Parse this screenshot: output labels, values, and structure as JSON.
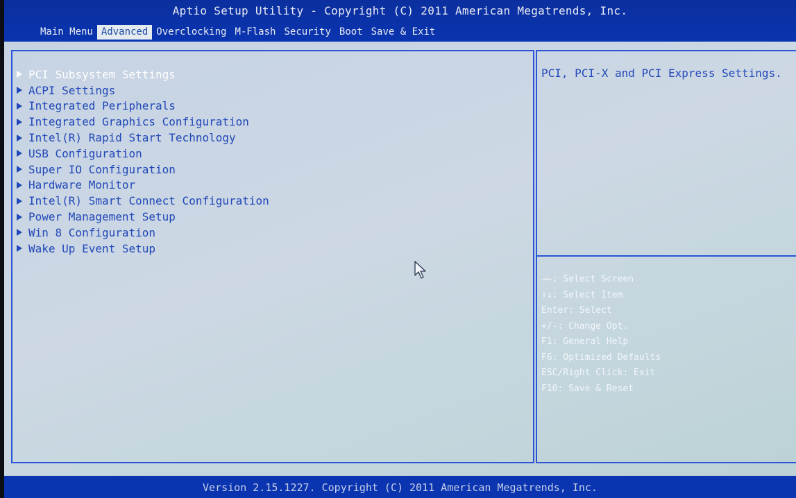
{
  "header": {
    "title": "Aptio Setup Utility - Copyright (C) 2011 American Megatrends, Inc.",
    "tabs": [
      {
        "label": "Main Menu",
        "active": false
      },
      {
        "label": "Advanced",
        "active": true
      },
      {
        "label": "Overclocking",
        "active": false
      },
      {
        "label": "M-Flash",
        "active": false
      },
      {
        "label": "Security",
        "active": false
      },
      {
        "label": "Boot",
        "active": false
      },
      {
        "label": "Save & Exit",
        "active": false
      }
    ]
  },
  "menu": {
    "items": [
      {
        "label": "PCI Subsystem Settings",
        "selected": true
      },
      {
        "label": "ACPI Settings",
        "selected": false
      },
      {
        "label": "Integrated Peripherals",
        "selected": false
      },
      {
        "label": "Integrated Graphics Configuration",
        "selected": false
      },
      {
        "label": "Intel(R) Rapid Start Technology",
        "selected": false
      },
      {
        "label": "USB Configuration",
        "selected": false
      },
      {
        "label": "Super IO Configuration",
        "selected": false
      },
      {
        "label": "Hardware Monitor",
        "selected": false
      },
      {
        "label": "Intel(R) Smart Connect Configuration",
        "selected": false
      },
      {
        "label": "Power Management Setup",
        "selected": false
      },
      {
        "label": "Win 8 Configuration",
        "selected": false
      },
      {
        "label": "Wake Up Event Setup",
        "selected": false
      }
    ]
  },
  "help": {
    "text": "PCI, PCI-X and PCI Express Settings."
  },
  "keys": [
    "→←: Select Screen",
    "↑↓: Select Item",
    "Enter: Select",
    "+/-: Change Opt.",
    "F1: General Help",
    "F6: Optimized Defaults",
    "ESC/Right Click: Exit",
    "F10: Save & Reset"
  ],
  "footer": {
    "version": "Version 2.15.1227. Copyright (C) 2011 American Megatrends, Inc."
  },
  "colors": {
    "header_blue": "#0a34b0",
    "panel_border": "#2a55d6",
    "menu_text": "#2148b8",
    "selected_text": "#ffffff",
    "active_tab_bg": "#e3ebef"
  }
}
